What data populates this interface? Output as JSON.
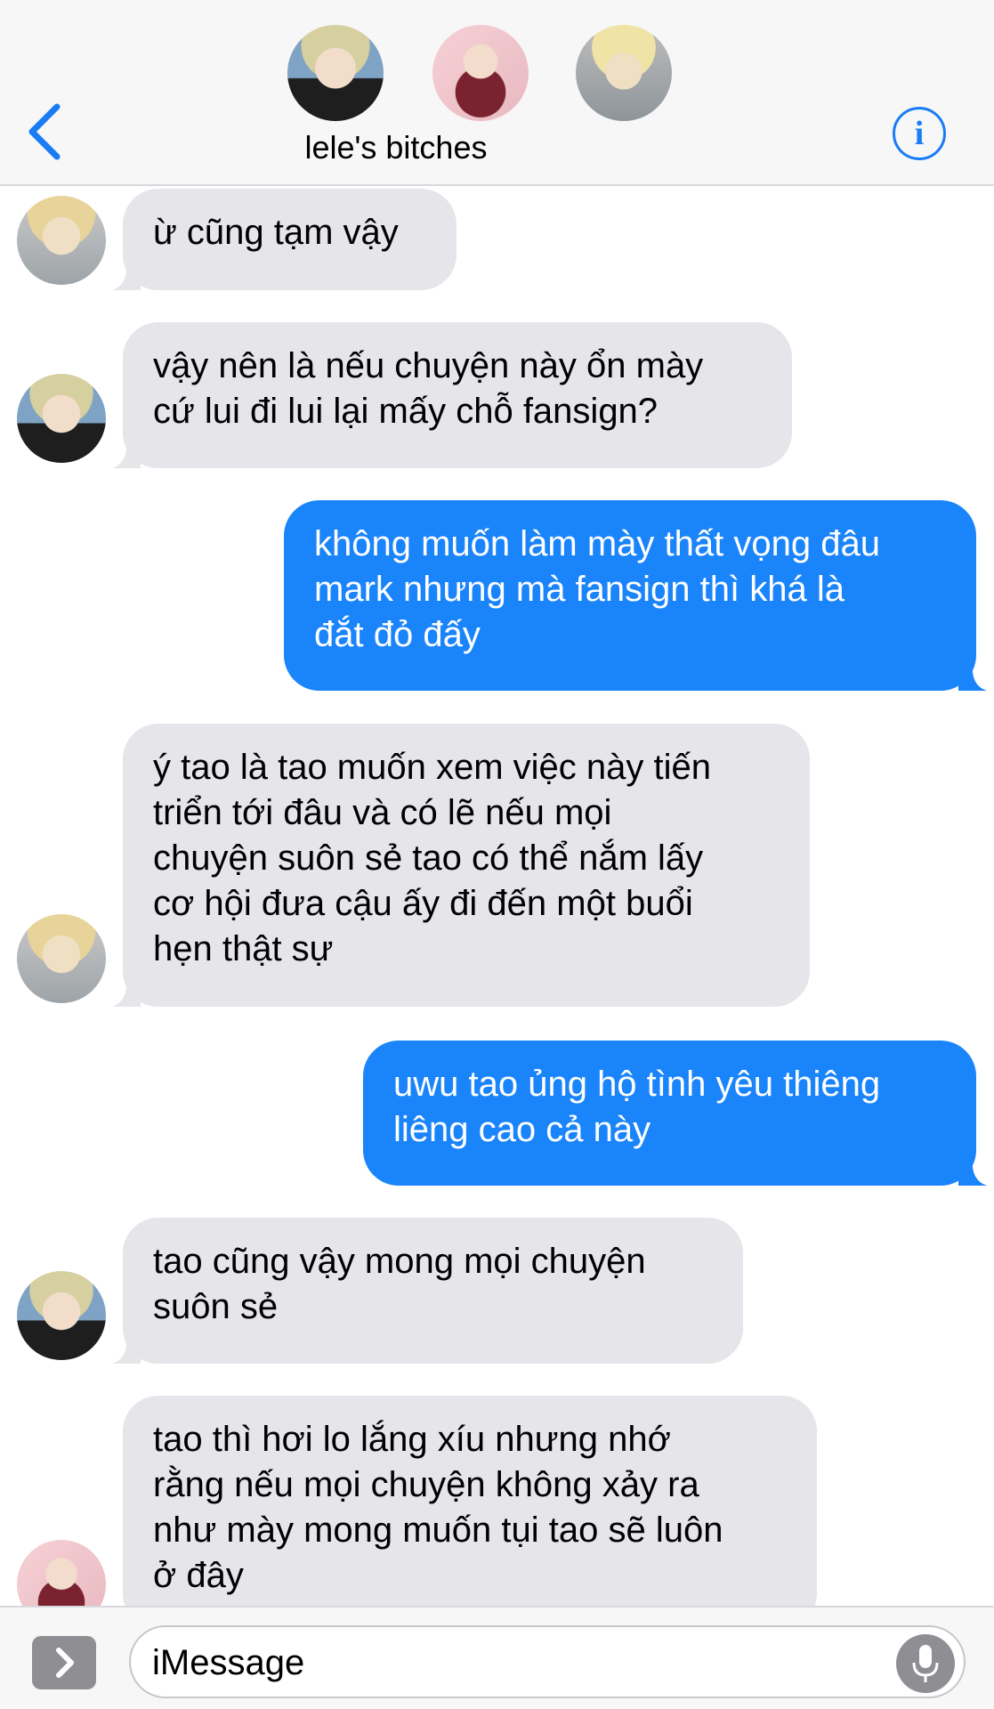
{
  "header": {
    "group_name": "lele's bitches",
    "info_label": "i",
    "accent_color": "#1a7cf5"
  },
  "messages": [
    {
      "direction": "incoming",
      "text": "ừ cũng tạm vậy"
    },
    {
      "direction": "incoming",
      "text": "vậy nên là nếu chuyện này ổn mày\ncứ lui đi lui lại mấy chỗ fansign?"
    },
    {
      "direction": "outgoing",
      "text": "không muốn làm mày thất vọng đâu\nmark nhưng mà fansign thì khá là\nđắt đỏ đấy"
    },
    {
      "direction": "incoming",
      "text": "ý tao là tao muốn xem việc này tiến\ntriển tới đâu và có lẽ nếu mọi\nchuyện suôn sẻ tao có thể nắm lấy\ncơ hội đưa cậu ấy đi đến một buổi\nhẹn thật sự"
    },
    {
      "direction": "outgoing",
      "text": "uwu tao ủng hộ tình yêu thiêng\nliêng cao cả này"
    },
    {
      "direction": "incoming",
      "text": "tao cũng vậy mong mọi chuyện\nsuôn sẻ"
    },
    {
      "direction": "incoming",
      "text": "tao thì hơi lo lắng xíu nhưng nhớ\nrằng nếu mọi chuyện không xảy ra\nnhư mày mong muốn tụi tao sẽ luôn\nở đây"
    }
  ],
  "input": {
    "placeholder": "iMessage"
  },
  "colors": {
    "incoming_bubble": "#e5e5ea",
    "outgoing_bubble": "#1a84fb"
  }
}
